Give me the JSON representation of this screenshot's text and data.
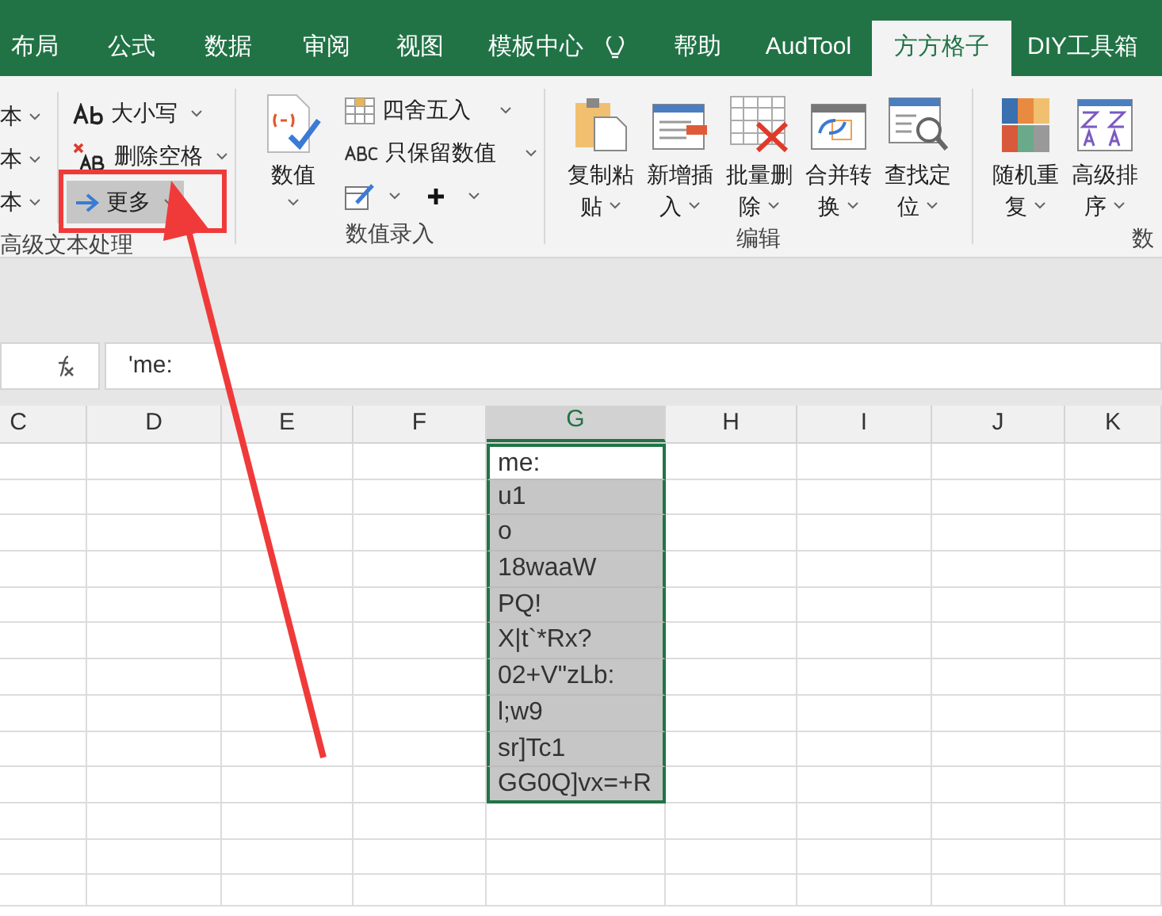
{
  "ribbon_tabs": [
    {
      "label": "布局",
      "selected": false
    },
    {
      "label": "公式",
      "selected": false
    },
    {
      "label": "数据",
      "selected": false
    },
    {
      "label": "审阅",
      "selected": false
    },
    {
      "label": "视图",
      "selected": false
    },
    {
      "label": "模板中心",
      "selected": false
    },
    {
      "label": "帮助",
      "selected": false
    },
    {
      "label": "AudTool",
      "selected": false
    },
    {
      "label": "方方格子",
      "selected": true
    },
    {
      "label": "DIY工具箱",
      "selected": false
    }
  ],
  "text_group": {
    "cut_items": [
      "本",
      "本",
      "本"
    ],
    "items": [
      {
        "kind": "ab",
        "label": "大小写",
        "highlighted": false
      },
      {
        "kind": "delete",
        "label": "删除空格",
        "highlighted": false
      },
      {
        "kind": "arrow",
        "label": "更多",
        "highlighted": true
      }
    ],
    "label": "高级文本处理"
  },
  "number_group": {
    "big_button": "数值",
    "items": [
      "四舍五入",
      "只保留数值"
    ],
    "label": "数值录入"
  },
  "edit_group": {
    "buttons": [
      {
        "kind": "paste",
        "line1": "复制粘",
        "line2": "贴"
      },
      {
        "kind": "insert",
        "line1": "新增插",
        "line2": "入"
      },
      {
        "kind": "delete",
        "line1": "批量删",
        "line2": "除"
      },
      {
        "kind": "convert",
        "line1": "合并转",
        "line2": "换"
      },
      {
        "kind": "find",
        "line1": "查找定",
        "line2": "位"
      }
    ],
    "label": "编辑"
  },
  "data_group": {
    "buttons": [
      {
        "kind": "blocks",
        "line1": "随机重",
        "line2": "复"
      },
      {
        "kind": "sort",
        "line1": "高级排",
        "line2": "序"
      }
    ],
    "label": "数"
  },
  "formula_bar": {
    "value": "'me:"
  },
  "columns": [
    {
      "label": "C",
      "selected": false
    },
    {
      "label": "D",
      "selected": false
    },
    {
      "label": "E",
      "selected": false
    },
    {
      "label": "F",
      "selected": false
    },
    {
      "label": "G",
      "selected": true
    },
    {
      "label": "H",
      "selected": false
    },
    {
      "label": "I",
      "selected": false
    },
    {
      "label": "J",
      "selected": false
    },
    {
      "label": "K",
      "selected": false
    }
  ],
  "cells_g": [
    {
      "text": "me:",
      "highlighted": false
    },
    {
      "text": "u1",
      "highlighted": true
    },
    {
      "text": "o",
      "highlighted": true
    },
    {
      "text": "18waaW",
      "highlighted": true
    },
    {
      "text": "PQ!",
      "highlighted": true
    },
    {
      "text": "X|t`*Rx?",
      "highlighted": true
    },
    {
      "text": "02+V\"zLb:",
      "highlighted": true
    },
    {
      "text": "l;w9",
      "highlighted": true
    },
    {
      "text": "sr]Tc1",
      "highlighted": true
    },
    {
      "text": "GG0Q]vx=+R",
      "highlighted": true
    }
  ]
}
